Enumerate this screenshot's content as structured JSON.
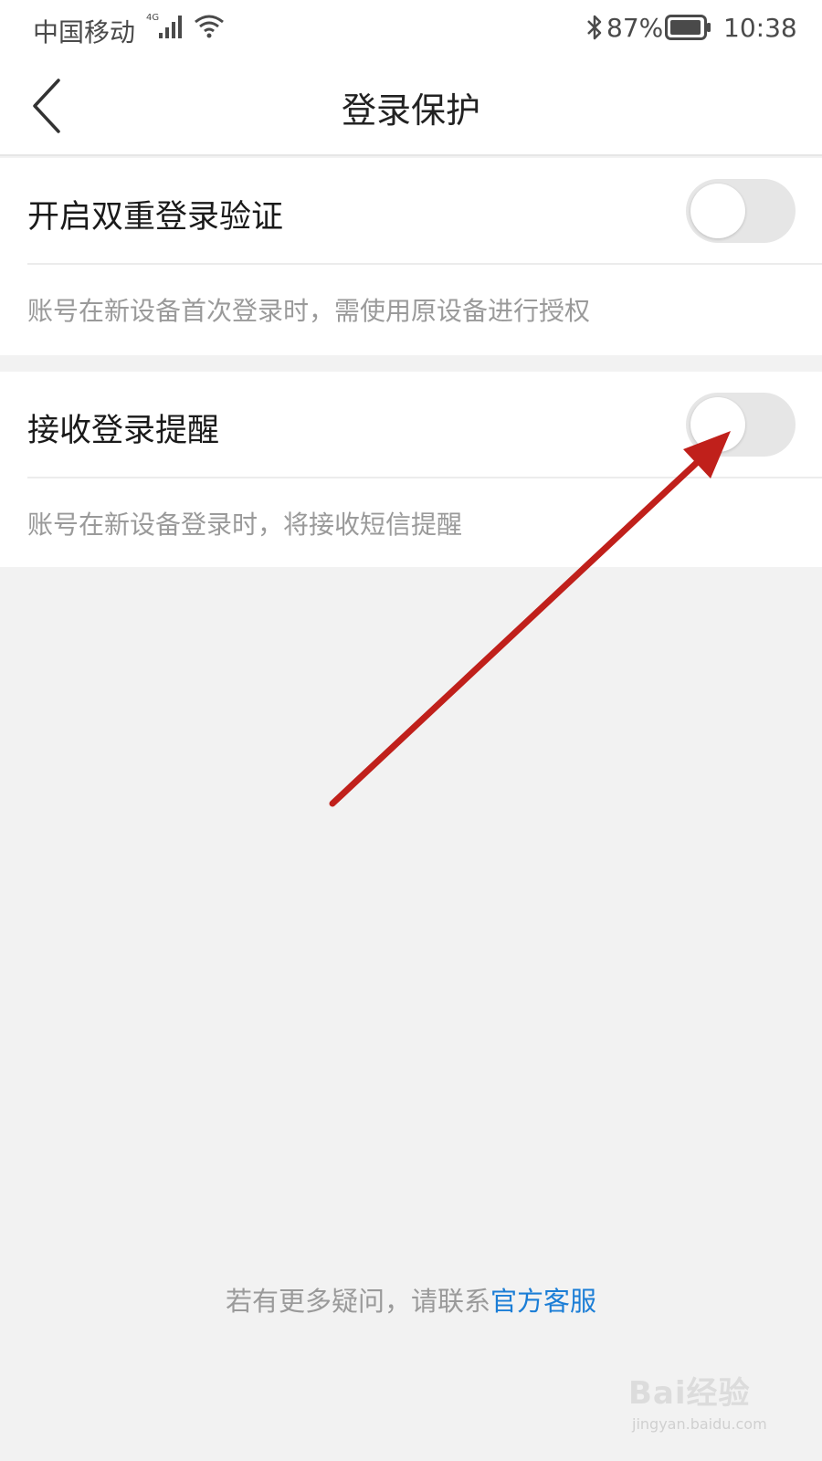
{
  "status_bar": {
    "carrier": "中国移动",
    "network_type": "4G",
    "battery_percent": "87%",
    "time": "10:38",
    "icons": [
      "signal-icon",
      "wifi-icon",
      "bluetooth-icon",
      "battery-icon"
    ]
  },
  "header": {
    "title": "登录保护",
    "back_icon": "chevron-left-icon"
  },
  "settings": [
    {
      "label": "开启双重登录验证",
      "description": "账号在新设备首次登录时，需使用原设备进行授权",
      "enabled": false
    },
    {
      "label": "接收登录提醒",
      "description": "账号在新设备登录时，将接收短信提醒",
      "enabled": false
    }
  ],
  "footer": {
    "text": "若有更多疑问，请联系",
    "link_text": "官方客服"
  },
  "watermark": {
    "main": "Bai经验",
    "sub": "jingyan.baidu.com"
  },
  "colors": {
    "link": "#1c7ed6",
    "arrow": "#c0201b",
    "toggle_off": "#e6e6e6",
    "background": "#f2f2f2"
  }
}
